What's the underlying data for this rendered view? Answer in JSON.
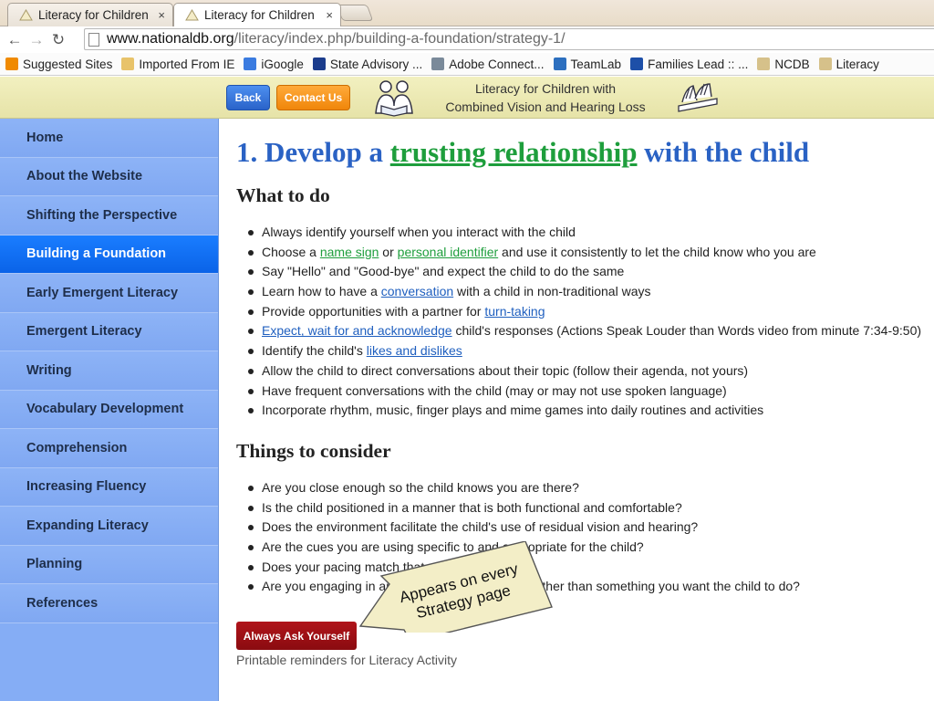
{
  "browser": {
    "tabs": [
      {
        "title": "Literacy for Children",
        "close": "×",
        "active": false
      },
      {
        "title": "Literacy for Children",
        "close": "×",
        "active": true
      }
    ],
    "url_host": "www.nationaldb.org",
    "url_path": "/literacy/index.php/building-a-foundation/strategy-1/",
    "bookmarks": [
      {
        "label": "Suggested Sites",
        "icon": "suggested-sites-icon",
        "color": "#f08a00"
      },
      {
        "label": "Imported From IE",
        "icon": "folder-icon",
        "color": "#e8c36a"
      },
      {
        "label": "iGoogle",
        "icon": "igoogle-icon",
        "color": "#3a7be0"
      },
      {
        "label": "State Advisory ...",
        "icon": "sap-icon",
        "color": "#1b3c8c"
      },
      {
        "label": "Adobe Connect...",
        "icon": "adobe-connect-icon",
        "color": "#7a8a9a"
      },
      {
        "label": "TeamLab",
        "icon": "teamlab-icon",
        "color": "#2c6fbf"
      },
      {
        "label": "Families Lead :: ...",
        "icon": "families-lead-icon",
        "color": "#1d4fa8"
      },
      {
        "label": "NCDB",
        "icon": "ncdb-icon",
        "color": "#d6c18a"
      },
      {
        "label": "Literacy",
        "icon": "literacy-icon",
        "color": "#d6c18a"
      }
    ]
  },
  "header": {
    "back_label": "Back",
    "contact_label": "Contact Us",
    "title_line1": "Literacy for Children with",
    "title_line2": "Combined Vision and Hearing Loss"
  },
  "sidebar": {
    "items": [
      {
        "label": "Home",
        "active": false
      },
      {
        "label": "About the Website",
        "active": false
      },
      {
        "label": "Shifting the Perspective",
        "active": false
      },
      {
        "label": "Building a Foundation",
        "active": true
      },
      {
        "label": "Early Emergent Literacy",
        "active": false
      },
      {
        "label": "Emergent Literacy",
        "active": false
      },
      {
        "label": "Writing",
        "active": false
      },
      {
        "label": "Vocabulary Development",
        "active": false
      },
      {
        "label": "Comprehension",
        "active": false
      },
      {
        "label": "Increasing Fluency",
        "active": false
      },
      {
        "label": "Expanding Literacy",
        "active": false
      },
      {
        "label": "Planning",
        "active": false
      },
      {
        "label": "References",
        "active": false
      }
    ]
  },
  "main": {
    "title_prefix": "1. Develop a ",
    "title_keyword": "trusting relationship",
    "title_suffix": " with the child",
    "what_heading": "What to do",
    "what_items": [
      {
        "parts": [
          {
            "t": "Always identify yourself when you interact with the child"
          }
        ]
      },
      {
        "parts": [
          {
            "t": "Choose a "
          },
          {
            "t": "name sign",
            "link": "green"
          },
          {
            "t": " or "
          },
          {
            "t": "personal identifier",
            "link": "green"
          },
          {
            "t": " and use it consistently to let the child know who you are"
          }
        ]
      },
      {
        "parts": [
          {
            "t": "Say \"Hello\" and \"Good-bye\" and expect the child to do the same"
          }
        ]
      },
      {
        "parts": [
          {
            "t": "Learn how to have a "
          },
          {
            "t": "conversation",
            "link": "blue"
          },
          {
            "t": " with a child in non-traditional ways"
          }
        ]
      },
      {
        "parts": [
          {
            "t": "Provide opportunities with a partner for "
          },
          {
            "t": "turn-taking",
            "link": "blue"
          }
        ]
      },
      {
        "parts": [
          {
            "t": "Expect, wait for and acknowledge",
            "link": "blue"
          },
          {
            "t": " child's responses (Actions Speak Louder than Words video from minute 7:34-9:50)"
          }
        ]
      },
      {
        "parts": [
          {
            "t": "Identify the child's "
          },
          {
            "t": "likes and dislikes",
            "link": "blue"
          }
        ]
      },
      {
        "parts": [
          {
            "t": "Allow the child to direct conversations about their topic (follow their agenda, not yours)"
          }
        ]
      },
      {
        "parts": [
          {
            "t": "Have frequent conversations with the child (may or may not use spoken language)"
          }
        ]
      },
      {
        "parts": [
          {
            "t": "Incorporate rhythm, music, finger plays and mime games into daily routines and activities"
          }
        ]
      }
    ],
    "consider_heading": "Things to consider",
    "consider_items": [
      "Are you close enough so the child knows you are there?",
      "Is the child positioned in a manner that is both functional and comfortable?",
      "Does the environment facilitate the child's use of residual vision and hearing?",
      "Are the cues you are using specific to and appropriate for the child?",
      "Does your pacing match that of the child?",
      "Are you engaging in an activity the child enjoys rather than something you want the child to do?"
    ],
    "ask_label": "Always Ask Yourself",
    "printable": "Printable reminders for Literacy Activity"
  },
  "callout": {
    "line1": "Appears on every",
    "line2": "Strategy page"
  },
  "colors": {
    "sidebar_bg": "#85adf5",
    "sidebar_active": "#0a63e8",
    "title_blue": "#2a62c4",
    "link_green": "#1e9e3c",
    "link_blue": "#1f5fbf",
    "ask_red": "#9a0f14",
    "callout_fill": "#f3eec7"
  }
}
